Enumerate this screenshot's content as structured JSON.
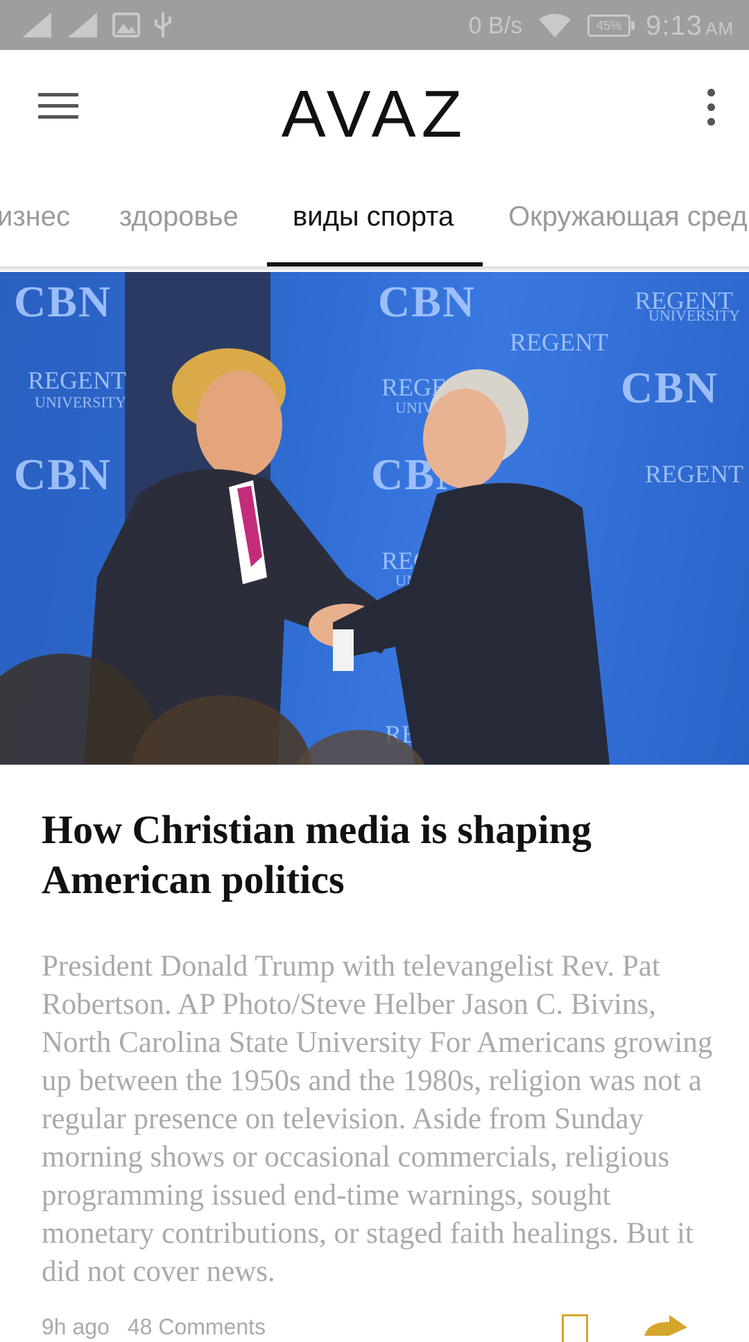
{
  "status_bar": {
    "network_speed": "0 B/s",
    "battery": "45%",
    "time": "9:13",
    "ampm": "AM"
  },
  "app_bar": {
    "logo": "AVAZ"
  },
  "tabs": [
    "изнес",
    "здоровье",
    "виды спорта",
    "Окружающая сред"
  ],
  "active_tab": "виды спорта",
  "hero": {
    "wall_text": [
      "CBN",
      "REGENT",
      "UNIVERSITY"
    ]
  },
  "article": {
    "headline": "How Christian media is shaping American politics",
    "summary": "President Donald Trump with televangelist Rev. Pat Robertson. AP Photo/Steve Helber Jason C. Bivins, North Carolina State University For Americans growing up between the 1950s and the 1980s, religion was not a regular presence on television. Aside from Sunday morning shows or occasional commercials, religious programming issued end-time warnings, sought monetary contributions, or staged faith healings. But it did not cover news.",
    "age": "9h ago",
    "comments": "48 Comments"
  },
  "colors": {
    "accent": "#d4a62a",
    "status_bar": "#9e9e9e"
  }
}
